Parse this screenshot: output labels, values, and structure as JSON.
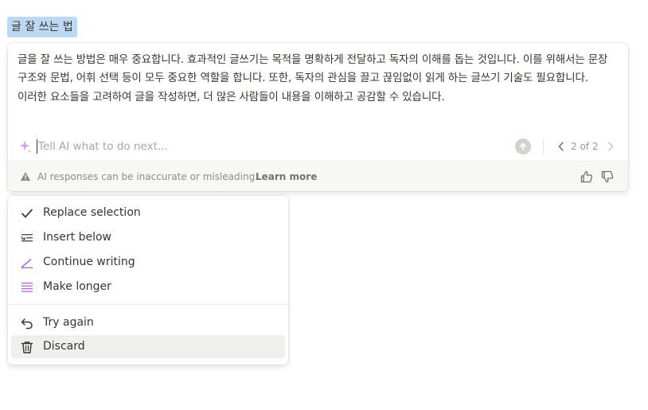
{
  "selection": {
    "title": "글 잘 쓰는 법"
  },
  "ai": {
    "response": "글을 잘 쓰는 방법은 매우 중요합니다. 효과적인 글쓰기는 목적을 명확하게 전달하고 독자의 이해를 돕는 것입니다. 이를 위해서는 문장 구조와 문법, 어휘 선택 등이 모두 중요한 역할을 합니다. 또한, 독자의 관심을 끌고 끊임없이 읽게 하는 글쓰기 기술도 필요합니다. 이러한 요소들을 고려하여 글을 작성하면, 더 많은 사람들이 내용을 이해하고 공감할 수 있습니다.",
    "prompt_placeholder": "Tell AI what to do next...",
    "prompt_value": "",
    "pager": {
      "label": "2 of 2",
      "current": 2,
      "total": 2
    },
    "disclaimer": "AI responses can be inaccurate or misleading.",
    "learn_more": "Learn more",
    "accent_color": "#a66cd6"
  },
  "menu": {
    "items": [
      {
        "label": "Replace selection",
        "icon": "checkmark-icon"
      },
      {
        "label": "Insert below",
        "icon": "insert-below-icon"
      },
      {
        "label": "Continue writing",
        "icon": "pen-line-icon"
      },
      {
        "label": "Make longer",
        "icon": "lines-icon"
      }
    ],
    "secondary_items": [
      {
        "label": "Try again",
        "icon": "undo-arrow-icon"
      },
      {
        "label": "Discard",
        "icon": "trash-icon",
        "highlighted": true
      }
    ]
  }
}
